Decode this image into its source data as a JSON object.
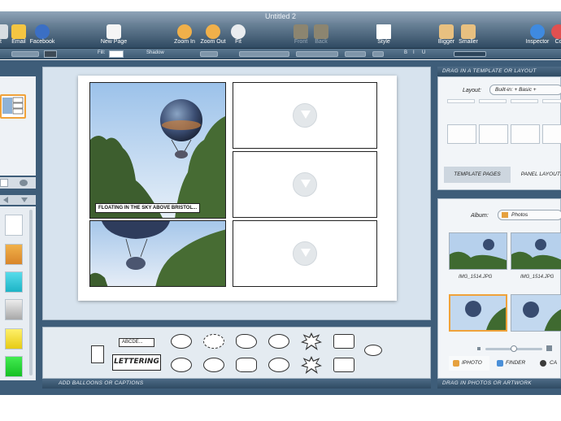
{
  "window": {
    "title": "Untitled 2"
  },
  "toolbar": {
    "items": [
      {
        "label": "t",
        "icon": "print-icon",
        "enabled": true
      },
      {
        "label": "Email",
        "icon": "email-icon",
        "enabled": true
      },
      {
        "label": "Facebook",
        "icon": "facebook-icon",
        "enabled": true
      },
      {
        "label": "New Page",
        "icon": "new-page-icon",
        "enabled": true
      },
      {
        "label": "Zoom In",
        "icon": "zoom-in-icon",
        "enabled": true
      },
      {
        "label": "Zoom Out",
        "icon": "zoom-out-icon",
        "enabled": true
      },
      {
        "label": "Fit",
        "icon": "zoom-fit-icon",
        "enabled": true
      },
      {
        "label": "Front",
        "icon": "bring-front-icon",
        "enabled": false
      },
      {
        "label": "Back",
        "icon": "send-back-icon",
        "enabled": false
      },
      {
        "label": "Style",
        "icon": "style-icon",
        "enabled": true
      },
      {
        "label": "Bigger",
        "icon": "bigger-icon",
        "enabled": true
      },
      {
        "label": "Smaller",
        "icon": "smaller-icon",
        "enabled": true
      },
      {
        "label": "Inspector",
        "icon": "inspector-icon",
        "enabled": true
      },
      {
        "label": "Co",
        "icon": "colors-icon",
        "enabled": true
      }
    ]
  },
  "formatbar": {
    "fill_label": "Fill:",
    "shadow_label": "Shadow",
    "style_buttons": [
      "B",
      "I",
      "U"
    ]
  },
  "comic": {
    "caption": "Floating in the sky above Bristol..."
  },
  "tray": {
    "title": "Add balloons or captions",
    "caption_sample": "ABCDE...",
    "lettering_label": "LETTERING"
  },
  "templates": {
    "title": "Drag in a template or layout",
    "layout_label": "Layout:",
    "layout_value": "Built-in: + Basic +",
    "tabs": [
      "Template Pages",
      "Panel Layouts"
    ]
  },
  "photos": {
    "album_label": "Album:",
    "album_value": "Photos",
    "captions": [
      "IMG_1514.JPG",
      "IMG_1514.JPG"
    ],
    "tabs": [
      "iPhoto",
      "Finder",
      "Ca"
    ],
    "footer": "Drag in photos or artwork"
  },
  "colors": {
    "accent": "#f0a23a",
    "toolbar": "#3d5a73",
    "swatches": [
      "#ffffff",
      "#e39a2e",
      "#2fc7d6",
      "#c8c8c8",
      "#f2de1c",
      "#1ccf2a"
    ]
  }
}
